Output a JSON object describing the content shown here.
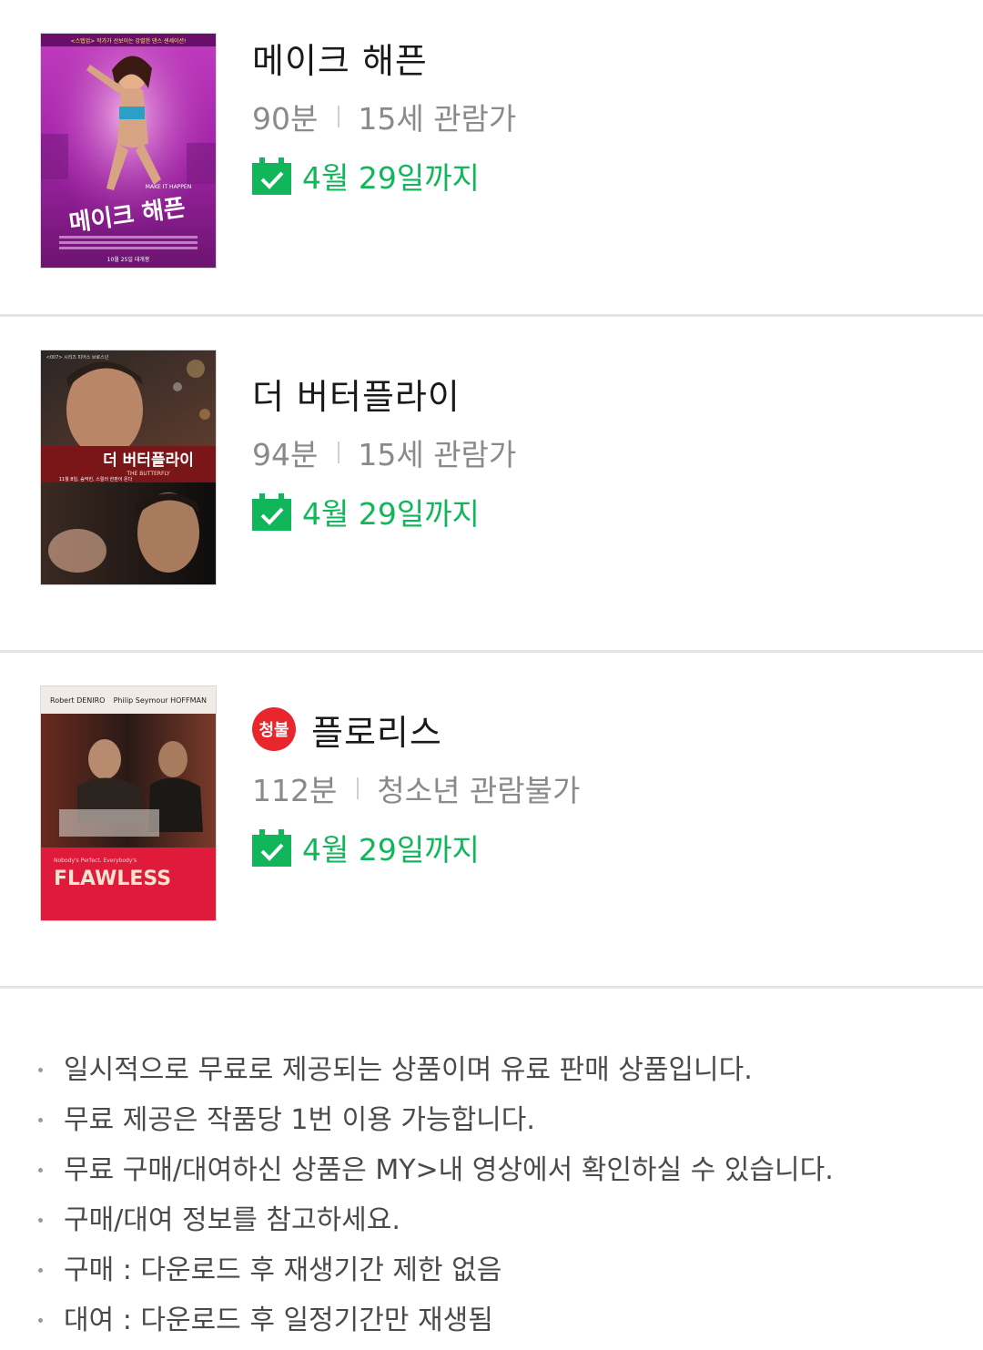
{
  "movies": [
    {
      "title": "메이크 해픈",
      "runtime": "90분",
      "rating": "15세 관람가",
      "until": "4월 29일까지",
      "adult_badge": "",
      "poster": {
        "top_text": "<스텝업> 작가가 선보이는 강렬한 댄스 센세이션!",
        "title_text": "메이크 해픈",
        "english_text": "MAKE IT HAPPEN",
        "date_text": "10월 25일 대개봉"
      }
    },
    {
      "title": "더 버터플라이",
      "runtime": "94분",
      "rating": "15세 관람가",
      "until": "4월 29일까지",
      "adult_badge": "",
      "poster": {
        "top_text": "<007> 시리즈 피어스 브로스넌",
        "title_text": "더 버터플라이",
        "english_text": "THE BUTTERFLY",
        "date_text": "11월 8일, 숨막힌, 스릴러 한판이 온다"
      }
    },
    {
      "title": "플로리스",
      "runtime": "112분",
      "rating": "청소년 관람불가",
      "until": "4월 29일까지",
      "adult_badge": "청불",
      "poster": {
        "top_left": "Robert DENIRO",
        "top_right": "Philip Seymour HOFFMAN",
        "tagline": "Nobody's Perfect. Everybody's",
        "title_text": "FLAWLESS"
      }
    }
  ],
  "notes": [
    "일시적으로 무료로 제공되는 상품이며 유료 판매 상품입니다.",
    "무료 제공은 작품당 1번 이용 가능합니다.",
    "무료 구매/대여하신 상품은 MY>내 영상에서 확인하실 수 있습니다.",
    "구매/대여 정보를 참고하세요.",
    "구매 : 다운로드 후 재생기간 제한 없음",
    "대여 : 다운로드 후 일정기간만 재생됨"
  ],
  "colors": {
    "accent_green": "#12b65a",
    "adult_red": "#e8262b"
  }
}
